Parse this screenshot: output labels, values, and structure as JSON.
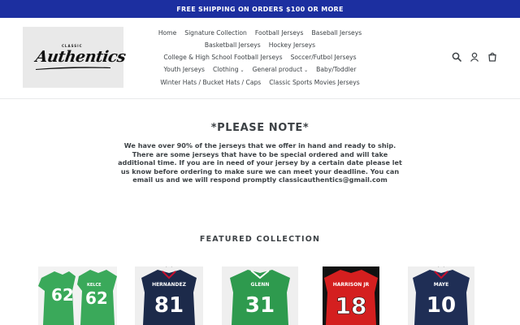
{
  "announcement": "FREE SHIPPING ON ORDERS $100 OR MORE",
  "logo": {
    "small_text": "CLASSIC",
    "script_text": "Authentics"
  },
  "nav": {
    "rows": [
      [
        "Home",
        "Signature Collection",
        "Football Jerseys",
        "Baseball Jerseys"
      ],
      [
        "Basketball Jerseys",
        "Hockey Jerseys"
      ],
      [
        "College & High School Football Jerseys",
        "Soccer/Futbol Jerseys"
      ],
      [
        "Youth Jerseys",
        "Clothing",
        "General product",
        "Baby/Toddler"
      ],
      [
        "Winter Hats / Bucket Hats / Caps",
        "Classic Sports Movies Jerseys"
      ]
    ],
    "dropdown_items": [
      "Clothing",
      "General product"
    ]
  },
  "icons": [
    "search-icon",
    "account-icon",
    "cart-icon"
  ],
  "note": {
    "title": "*PLEASE NOTE*",
    "body": "We have over 90% of the jerseys that we offer in hand and ready to ship. There are some jerseys that have to be special ordered and will take additional time. If you are in need of your jersey by a certain date please let us know before ordering to make sure we can meet your deadline. You can email us and we will respond promptly classicauthentics@gmail.com"
  },
  "featured_title": "FEATURED COLLECTION",
  "products": [
    {
      "name_text": "KELCE",
      "number": "62",
      "colors": {
        "body": "#3aa95a",
        "numbers": "#ffffff"
      }
    },
    {
      "name_text": "HERNANDEZ",
      "number": "81",
      "colors": {
        "body": "#1c2a4a",
        "numbers": "#ffffff"
      }
    },
    {
      "name_text": "GLENN",
      "number": "31",
      "colors": {
        "body": "#2e9a4e",
        "numbers": "#ffffff"
      }
    },
    {
      "name_text": "HARRISON JR",
      "number": "18",
      "colors": {
        "body": "#d41f1f",
        "numbers": "#ffffff"
      }
    },
    {
      "name_text": "MAYE",
      "number": "10",
      "colors": {
        "body": "#1f2e55",
        "numbers": "#ffffff"
      }
    }
  ]
}
